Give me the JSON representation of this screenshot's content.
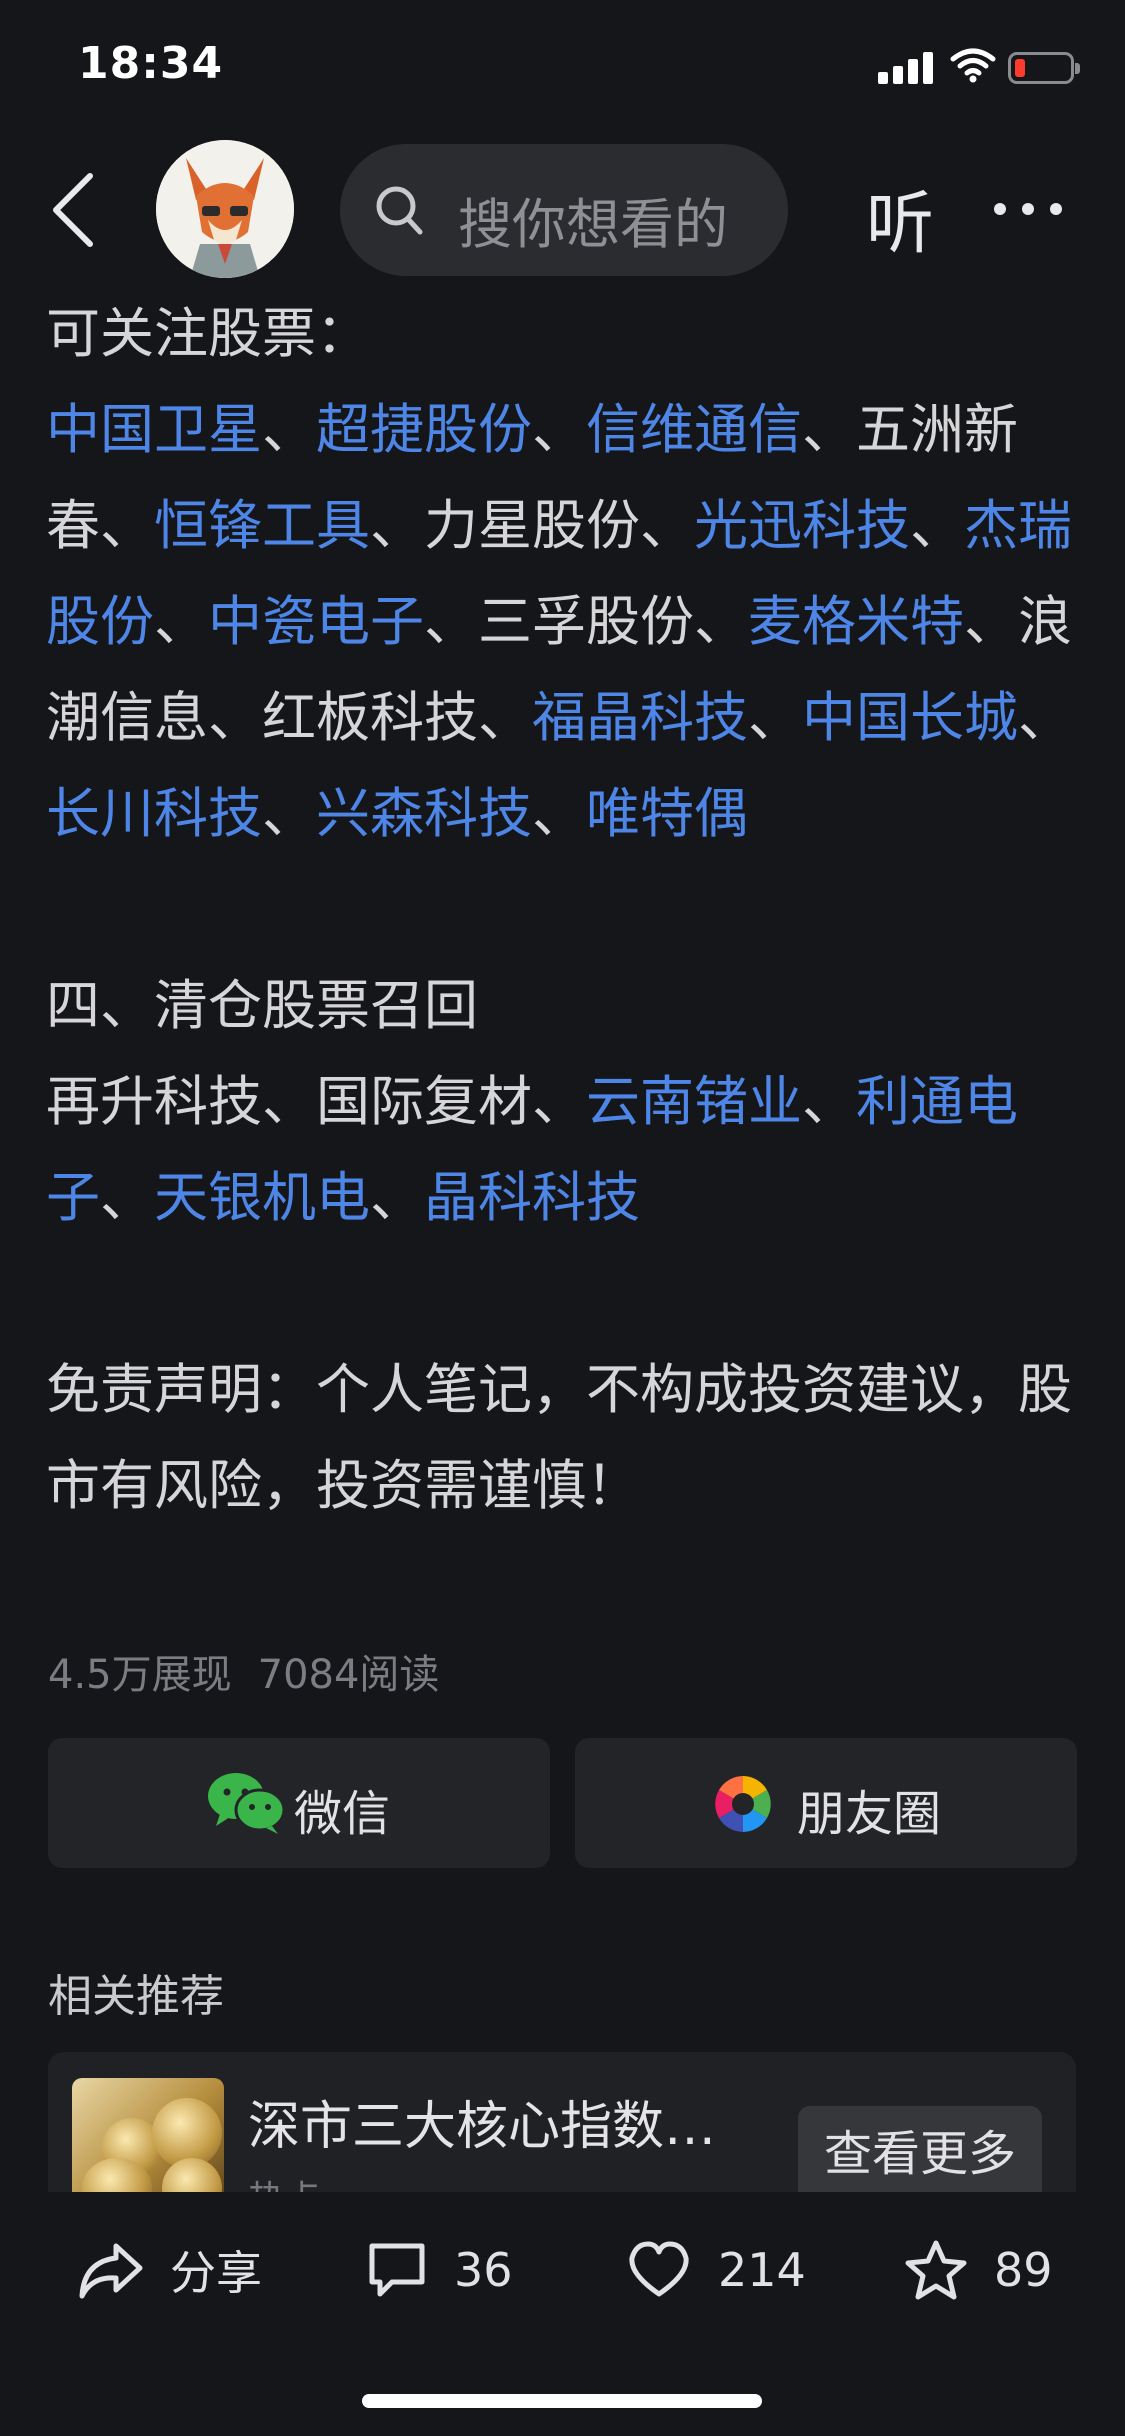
{
  "status_bar": {
    "time": "18:34"
  },
  "top_nav": {
    "search_placeholder": "搜你想看的",
    "listen_label": "听"
  },
  "article": {
    "heading_watch": "可关注股票：",
    "watch_stocks": [
      {
        "name": "中国卫星",
        "linked": true
      },
      {
        "name": "超捷股份",
        "linked": true
      },
      {
        "name": "信维通信",
        "linked": true
      },
      {
        "name": "五洲新春",
        "linked": false
      },
      {
        "name": "恒锋工具",
        "linked": true
      },
      {
        "name": "力星股份",
        "linked": false
      },
      {
        "name": "光迅科技",
        "linked": true
      },
      {
        "name": "杰瑞股份",
        "linked": true
      },
      {
        "name": "中瓷电子",
        "linked": true
      },
      {
        "name": "三孚股份",
        "linked": false
      },
      {
        "name": "麦格米特",
        "linked": true
      },
      {
        "name": "浪潮信息",
        "linked": false
      },
      {
        "name": "红板科技",
        "linked": false
      },
      {
        "name": "福晶科技",
        "linked": true
      },
      {
        "name": "中国长城",
        "linked": true
      },
      {
        "name": "长川科技",
        "linked": true
      },
      {
        "name": "兴森科技",
        "linked": true
      },
      {
        "name": "唯特偶",
        "linked": true
      }
    ],
    "heading_recall": "四、清仓股票召回",
    "recall_stocks": [
      {
        "name": "再升科技",
        "linked": false
      },
      {
        "name": "国际复材",
        "linked": false
      },
      {
        "name": "云南锗业",
        "linked": true
      },
      {
        "name": "利通电子",
        "linked": true
      },
      {
        "name": "天银机电",
        "linked": true
      },
      {
        "name": "晶科科技",
        "linked": true
      }
    ],
    "disclaimer": "免责声明：个人笔记，不构成投资建议，股市有风险，投资需谨慎！"
  },
  "stats": {
    "views": "4.5万展现",
    "reads": "7084阅读"
  },
  "share": {
    "wechat_label": "微信",
    "moments_label": "朋友圈"
  },
  "related": {
    "title": "相关推荐",
    "item_title": "深市三大核心指数…",
    "item_sub": "热点",
    "more_label": "查看更多"
  },
  "bottom_bar": {
    "share_label": "分享",
    "comments": "36",
    "likes": "214",
    "favorites": "89"
  },
  "colors": {
    "background": "#151619",
    "link": "#4e86e8",
    "text": "#d6d6d8"
  }
}
